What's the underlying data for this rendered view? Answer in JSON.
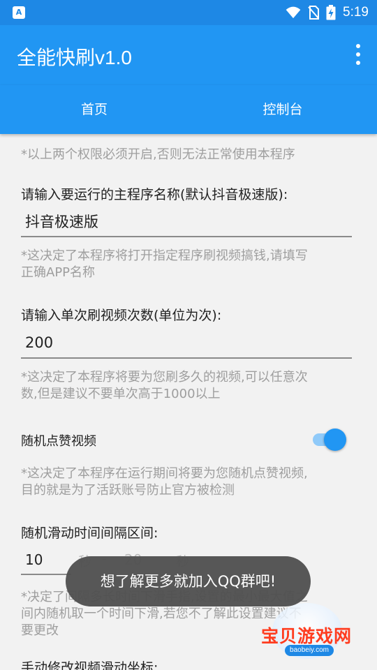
{
  "status_bar": {
    "notification_icon": "app-notification-icon",
    "notification_glyph": "A",
    "time": "5:19"
  },
  "app_bar": {
    "title": "全能快刷v1.0"
  },
  "tabs": [
    {
      "label": "首页",
      "selected": false
    },
    {
      "label": "控制台",
      "selected": true
    }
  ],
  "content": {
    "permission_hint": "*以上两个权限必须开启,否则无法正常使用本程序",
    "app_name": {
      "label": "请输入要运行的主程序名称(默认抖音极速版):",
      "value": "抖音极速版",
      "hint_line1": "*这决定了本程序将打开指定程序刷视频搞钱,请填写",
      "hint_line2": "正确APP名称"
    },
    "video_count": {
      "label": "请输入单次刷视频次数(单位为次):",
      "value": "200",
      "hint_line1": "*这决定了本程序将要为您刷多久的视频,可以任意次",
      "hint_line2": "数,但是建议不要单次高于1000以上"
    },
    "random_like": {
      "label": "随机点赞视频",
      "enabled": true,
      "hint_line1": "*这决定了本程序在运行期间将要为您随机点赞视频,",
      "hint_line2": "目的就是为了活跃账号防止官方被检测"
    },
    "swipe_interval": {
      "label": "随机滑动时间间隔区间:",
      "min": "10",
      "min_unit": "秒",
      "separator": "-",
      "max": "20",
      "max_unit": "秒",
      "hint_line1": "*决定了间隔多长时间下滑手指,设置的最小最大值之",
      "hint_line2": "间内随机取一个时间下滑,若您不了解此设置建议不",
      "hint_line3": "要更改"
    },
    "swipe_coords_label": "手动修改视频滑动坐标:"
  },
  "toast": {
    "message": "想了解更多就加入QQ群吧!"
  },
  "watermark": {
    "text": "宝贝游戏网",
    "url": "baobeiy.com"
  },
  "colors": {
    "primary": "#2196f3",
    "status_bar": "#1e88e5",
    "switch_track": "#90caf9",
    "hint_text": "#9e9e9e"
  }
}
